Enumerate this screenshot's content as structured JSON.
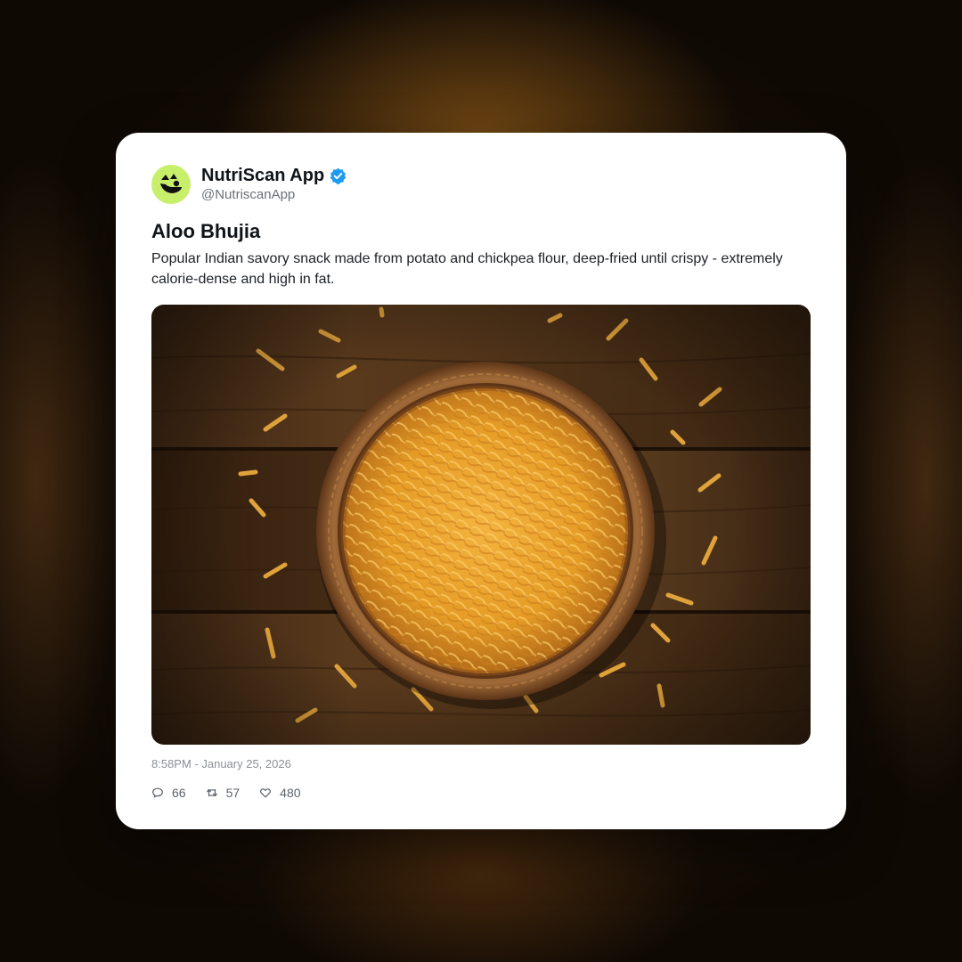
{
  "post": {
    "display_name": "NutriScan App",
    "handle": "@NutriscanApp",
    "verified": true,
    "title": "Aloo Bhujia",
    "description": "Popular Indian savory snack made from potato and chickpea flour, deep-fried until crispy - extremely calorie-dense and high in fat.",
    "image_subject": "bowl of aloo bhujia on wooden table",
    "timestamp": "8:58PM - January 25, 2026"
  },
  "stats": {
    "replies": "66",
    "reposts": "57",
    "likes": "480"
  },
  "icons": {
    "avatar": "nutriscan-logo-icon",
    "verified": "verified-badge-icon",
    "replies": "reply-icon",
    "reposts": "repost-icon",
    "likes": "heart-icon"
  },
  "colors": {
    "avatar_bg": "#c8ef6b",
    "verified_blue": "#1d9bf0",
    "card_bg": "#ffffff"
  }
}
